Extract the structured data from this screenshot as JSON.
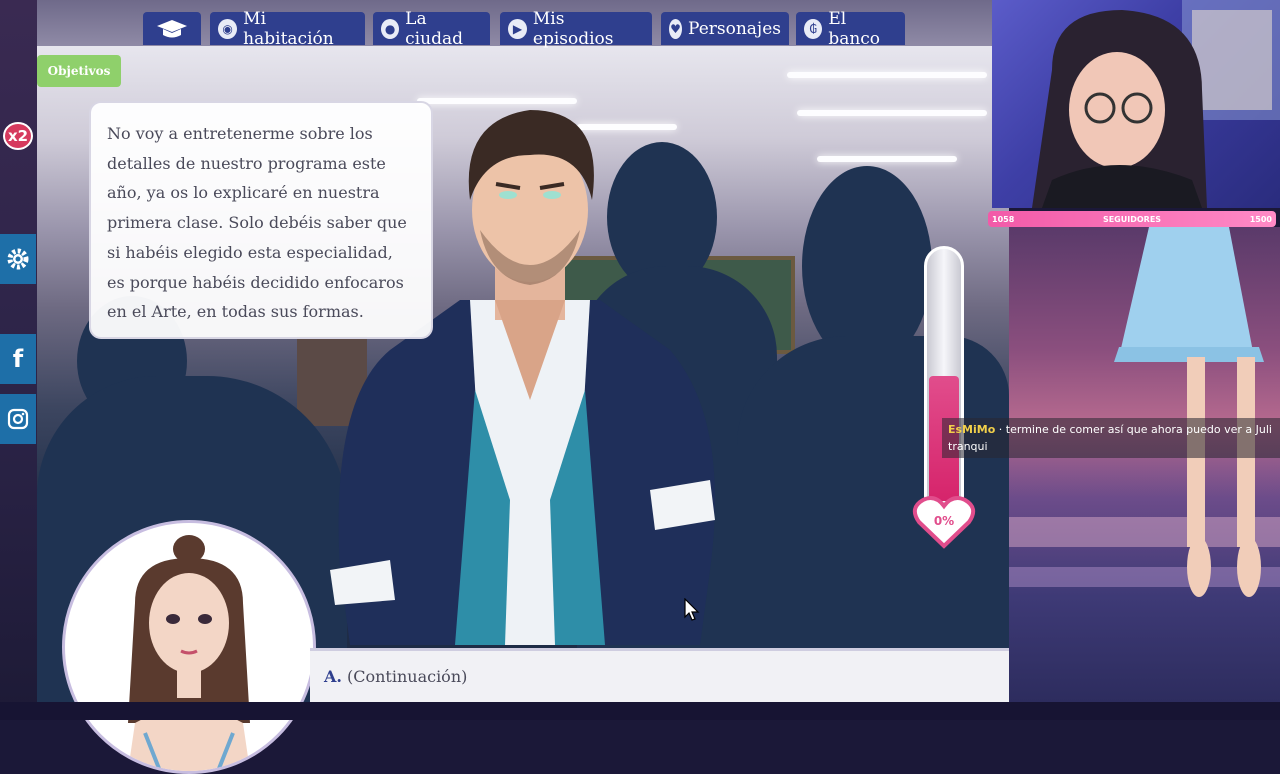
{
  "nav": {
    "items": [
      {
        "label": "Mi habitación",
        "icon": "compass-icon"
      },
      {
        "label": "La ciudad",
        "icon": "map-pin-icon"
      },
      {
        "label": "Mis episodios",
        "icon": "play-icon"
      },
      {
        "label": "Personajes",
        "icon": "heart-icon"
      },
      {
        "label": "El banco",
        "icon": "bank-icon"
      }
    ]
  },
  "sidebar": {
    "x2_label": "x2"
  },
  "objectives_label": "Objetivos",
  "dialog": {
    "text": "No voy a entretenerme sobre los detalles de nuestro programa este año, ya os lo explicaré en nuestra primera clase. Solo debéis saber que si habéis elegido esta especialidad, es porque habéis decidido enfocaros en el Arte, en todas sus formas."
  },
  "love_meter": {
    "percent_label": "0%",
    "level": 0
  },
  "choice": {
    "letter": "A.",
    "text": "(Continuación)"
  },
  "followers": {
    "current": "1058",
    "label": "SEGUIDORES",
    "goal": "1500",
    "fraction": 0.705
  },
  "chat": {
    "user": "EsMiMo",
    "message": "termine de comer así que ahora puedo ver a Juli tranqui"
  },
  "colors": {
    "nav_button": "#2f3f8e",
    "objectives": "#8fd06b",
    "meter_fill": "#e14d8c",
    "follower_bar": "#f25aa8"
  }
}
